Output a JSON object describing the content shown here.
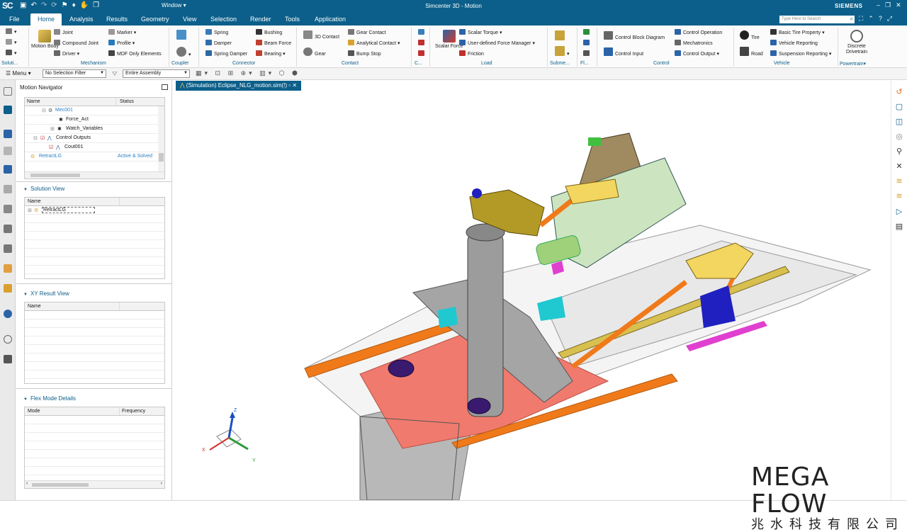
{
  "titlebar": {
    "app_badge": "SC",
    "window_menu": "Window",
    "title": "Simcenter 3D - Motion",
    "brand": "SIEMENS"
  },
  "menubar": {
    "tabs": [
      "File",
      "Home",
      "Analysis",
      "Results",
      "Geometry",
      "View",
      "Selection",
      "Render",
      "Tools",
      "Application"
    ],
    "active_tab": "Home",
    "search_placeholder": "Type Here to Search"
  },
  "ribbon": {
    "solution": {
      "label": "Soluti..."
    },
    "mechanism": {
      "label": "Mechanism",
      "motion_body": "Motion Body",
      "joint": "Joint",
      "compound_joint": "Compound Joint",
      "driver": "Driver",
      "marker": "Marker",
      "profile": "Profile",
      "mdf_only": "MDF Only Elements"
    },
    "coupler": {
      "label": "Coupler"
    },
    "connector": {
      "label": "Connector",
      "spring": "Spring",
      "damper": "Damper",
      "spring_damper": "Spring Damper",
      "bushing": "Bushing",
      "beam_force": "Beam Force",
      "bearing": "Bearing"
    },
    "contact": {
      "label": "Contact",
      "contact_3d": "3D Contact",
      "gear": "Gear",
      "gear_contact": "Gear Contact",
      "analytical_contact": "Analytical Contact",
      "bump_stop": "Bump Stop"
    },
    "c_group": {
      "label": "C..."
    },
    "load": {
      "label": "Load",
      "scalar_force": "Scalar Force",
      "scalar_torque": "Scalar Torque",
      "user_force_manager": "User-defined Force Manager",
      "friction": "Friction"
    },
    "submech": {
      "label": "Subme..."
    },
    "fl": {
      "label": "Fl..."
    },
    "control": {
      "label": "Control",
      "block_diagram": "Control Block Diagram",
      "control_input": "Control Input",
      "control_operation": "Control Operation",
      "mechatronics": "Mechatronics",
      "control_output": "Control Output"
    },
    "vehicle": {
      "label": "Vehicle",
      "tire": "Tire",
      "road": "Road",
      "basic_tire_property": "Basic Tire Property",
      "vehicle_reporting": "Vehicle Reporting",
      "suspension_reporting": "Suspension Reporting"
    },
    "powertrain": {
      "label": "Powertrain",
      "discrete_drivetrain": "Discrete Drivetrain"
    }
  },
  "toolbar": {
    "menu_label": "Menu",
    "selection_filter": "No Selection Filter",
    "assembly_scope": "Entire Assembly"
  },
  "navigator": {
    "title": "Motion Navigator",
    "col_name": "Name",
    "col_status": "Status",
    "rows": [
      {
        "label": "Mec001"
      },
      {
        "label": "Force_Act"
      },
      {
        "label": "Watch_Variables"
      },
      {
        "label": "Control Outputs"
      },
      {
        "label": "Cout001"
      },
      {
        "label": "RetractLG",
        "status": "Active & Solved"
      }
    ]
  },
  "solution_view": {
    "title": "Solution View",
    "col_name": "Name",
    "rows": [
      {
        "label": "RetractLG"
      }
    ]
  },
  "xy_result_view": {
    "title": "XY Result View",
    "col_name": "Name"
  },
  "flex_mode": {
    "title": "Flex Mode Details",
    "col_mode": "Mode",
    "col_frequency": "Frequency"
  },
  "viewport": {
    "tab_label": "(Simulation) Eclipse_NLG_motion.sim(!)",
    "axis_z": "Z",
    "axis_x": "X",
    "axis_y": "Y"
  },
  "watermark": {
    "line1": "MEGA FLOW",
    "line2": "兆水科技有限公司"
  }
}
